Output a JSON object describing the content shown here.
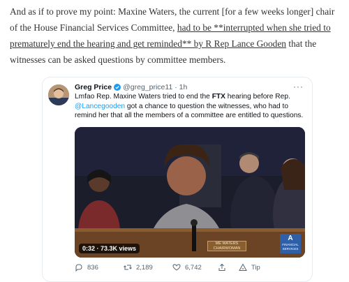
{
  "article": {
    "intro": "And as if to prove my point: Maxine Waters, the current [for a few weeks longer] chair of the House Financial Services Committee, ",
    "link": "had to be **interrupted when she tried to prematurely end the hearing and get reminded** by R Rep Lance Gooden",
    "outro": " that the witnesses can be asked questions by committee members."
  },
  "tweet": {
    "author": "Greg Price",
    "handle": "@greg_price11",
    "separator": "·",
    "time": "1h",
    "more": "···",
    "text_1": "Lmfao Rep. Maxine Waters tried to end the ",
    "text_bold": "FTX",
    "text_2": " hearing before Rep. ",
    "mention": "@Lancegooden",
    "text_3": " got a chance to question the witnesses, who had to remind her that all the members of a committee are entitled to questions.",
    "video": {
      "duration": "0:32",
      "views": "73.3K views",
      "nameplate_line1": "ME WATERS",
      "nameplate_line2": "CHAIRWOMAN",
      "badge_mark": "A",
      "badge_line1": "FINANCIAL",
      "badge_line2": "SERVICES"
    },
    "actions": {
      "replies": "836",
      "retweets": "2,189",
      "likes": "6,742",
      "tip": "Tip"
    }
  },
  "colors": {
    "link": "#1d9bf0",
    "muted": "#536471",
    "verified": "#1d9bf0"
  }
}
